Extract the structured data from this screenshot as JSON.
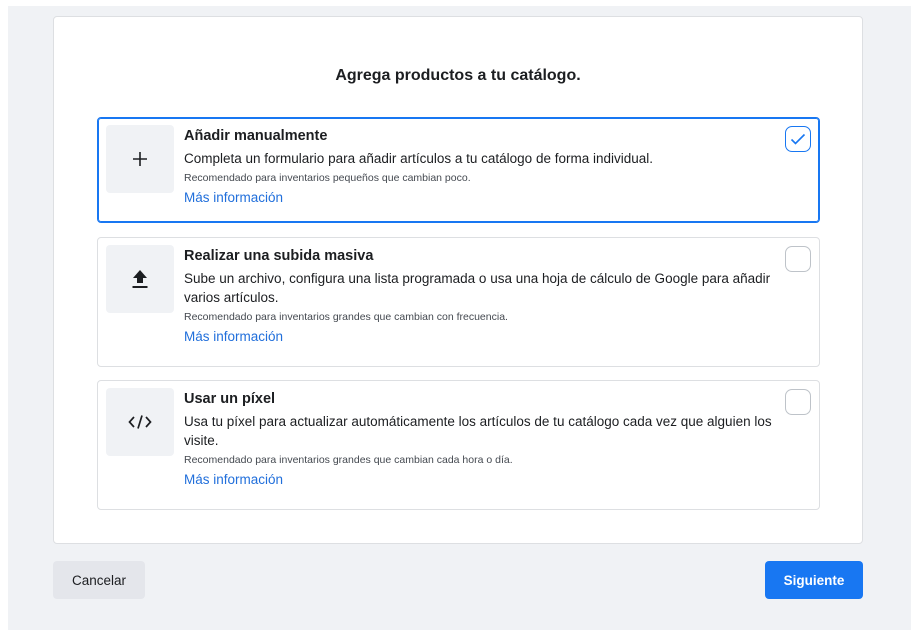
{
  "dialog": {
    "title": "Agrega productos a tu catálogo."
  },
  "options": [
    {
      "title": "Añadir manualmente",
      "description": "Completa un formulario para añadir artículos a tu catálogo de forma individual.",
      "note": "Recomendado para inventarios pequeños que cambian poco.",
      "link": "Más información",
      "icon": "plus-icon",
      "selected": true
    },
    {
      "title": "Realizar una subida masiva",
      "description": "Sube un archivo, configura una lista programada o usa una hoja de cálculo de Google para añadir varios artículos.",
      "note": "Recomendado para inventarios grandes que cambian con frecuencia.",
      "link": "Más información",
      "icon": "upload-icon",
      "selected": false
    },
    {
      "title": "Usar un píxel",
      "description": "Usa tu píxel para actualizar automáticamente los artículos de tu catálogo cada vez que alguien los visite.",
      "note": "Recomendado para inventarios grandes que cambian cada hora o día.",
      "link": "Más información",
      "icon": "code-icon",
      "selected": false
    }
  ],
  "footer": {
    "cancel_label": "Cancelar",
    "next_label": "Siguiente"
  },
  "colors": {
    "accent": "#1877f2",
    "link": "#216fdb",
    "background": "#f0f2f5"
  }
}
